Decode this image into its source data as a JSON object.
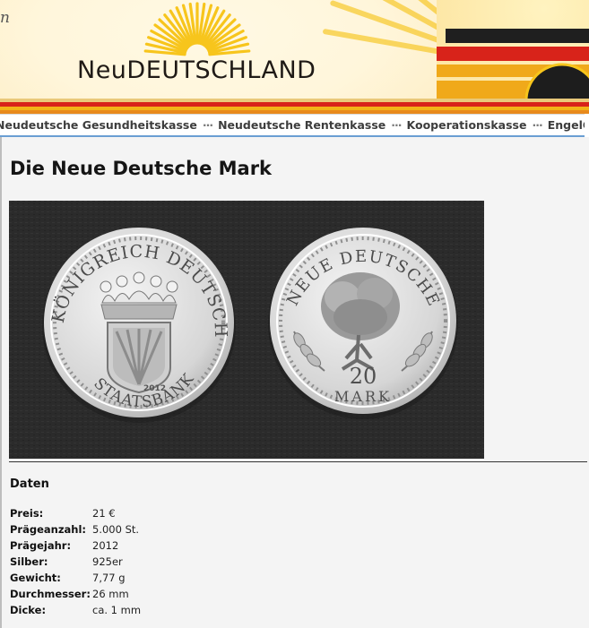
{
  "header": {
    "corner_letter": "n",
    "logo": {
      "part1": "Neu",
      "part2": "Deutschland"
    }
  },
  "nav": {
    "items": [
      {
        "label": "Neudeutsche Gesundheitskasse"
      },
      {
        "label": "Neudeutsche Rentenkasse"
      },
      {
        "label": "Kooperationskasse"
      },
      {
        "label": "EngelGeld"
      }
    ],
    "separator": "···"
  },
  "main": {
    "title": "Die Neue Deutsche Mark",
    "coin_left": {
      "top_text": "KÖNIGREICH DEUTSCHLAND",
      "bottom_text": "STAATSBANK",
      "year": "2012"
    },
    "coin_right": {
      "top_text": "NEUE DEUTSCHE",
      "value": "20",
      "unit": "MARK"
    },
    "data_section": {
      "title": "Daten",
      "rows": [
        {
          "label": "Preis:",
          "value": "21 €"
        },
        {
          "label": "Prägeanzahl:",
          "value": "5.000 St."
        },
        {
          "label": "Prägejahr:",
          "value": "2012"
        },
        {
          "label": "Silber:",
          "value": "925er"
        },
        {
          "label": "Gewicht:",
          "value": "7,77 g"
        },
        {
          "label": "Durchmesser:",
          "value": "26 mm"
        },
        {
          "label": "Dicke:",
          "value": "ca. 1 mm"
        }
      ]
    }
  },
  "colors": {
    "sun_yellow": "#f7c51c",
    "flag_black": "#1a1a1a",
    "flag_red": "#d8231a",
    "flag_gold": "#f2b318",
    "nav_border": "#6a9ed3",
    "coin_silver": "#d8d8d8",
    "photo_bg": "#2a2a2a"
  }
}
